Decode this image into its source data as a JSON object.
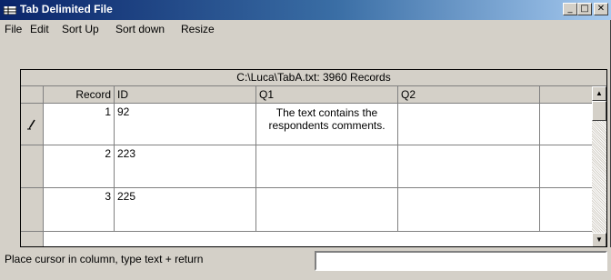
{
  "window": {
    "title": "Tab Delimited File",
    "icon": "grid-app-icon"
  },
  "title_buttons": {
    "minimize": "_",
    "maximize": "□",
    "close": "✕"
  },
  "menu": [
    "File",
    "Edit",
    "Sort Up",
    "Sort down",
    "Resize"
  ],
  "grid": {
    "caption": "C:\\Luca\\TabA.txt: 3960 Records",
    "columns": [
      "Record",
      "ID",
      "Q1",
      "Q2"
    ],
    "rows": [
      {
        "record": "1",
        "id": "92",
        "q1": "The text contains the respondents comments.",
        "q2": "",
        "edit_marker": "pencil-icon"
      },
      {
        "record": "2",
        "id": "223",
        "q1": "",
        "q2": ""
      },
      {
        "record": "3",
        "id": "225",
        "q1": "",
        "q2": ""
      }
    ]
  },
  "status": {
    "hint": "Place cursor in column, type text + return",
    "input_value": ""
  }
}
